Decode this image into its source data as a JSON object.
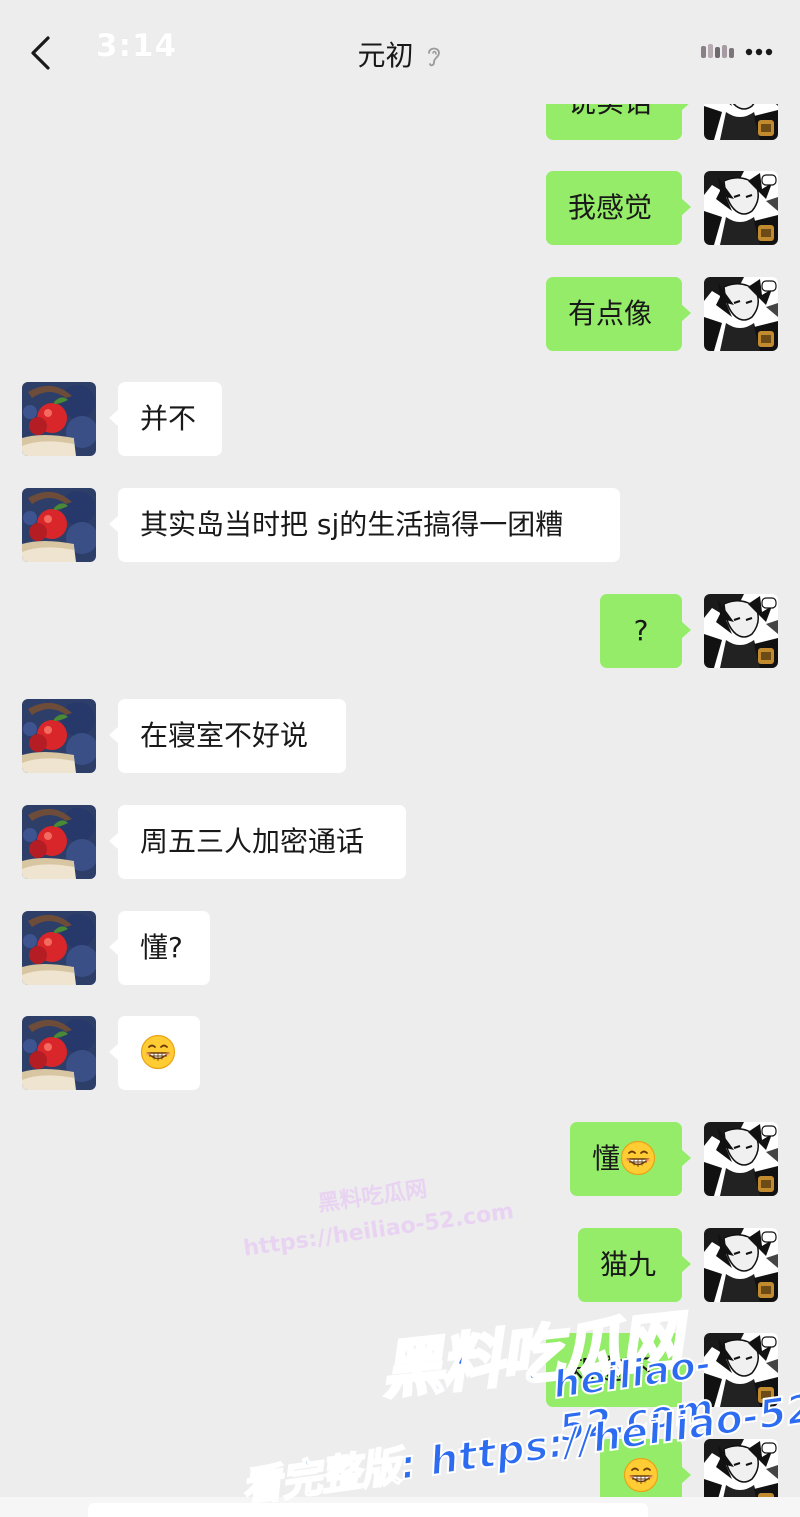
{
  "status_bar": {
    "time": "3:14"
  },
  "header": {
    "title": "元初"
  },
  "messages": [
    {
      "side": "right",
      "text": "说实话"
    },
    {
      "side": "right",
      "text": "我感觉"
    },
    {
      "side": "right",
      "text": "有点像"
    },
    {
      "side": "left",
      "text": "并不"
    },
    {
      "side": "left",
      "text": "其实岛当时把 sj的生活搞得一团糟"
    },
    {
      "side": "right",
      "text": "?"
    },
    {
      "side": "left",
      "text": "在寝室不好说"
    },
    {
      "side": "left",
      "text": "周五三人加密通话"
    },
    {
      "side": "left",
      "text": "懂?"
    },
    {
      "side": "left",
      "text": "",
      "emoji": "grin-emoji"
    },
    {
      "side": "right",
      "text": "懂",
      "emoji": "grin-emoji"
    },
    {
      "side": "right",
      "text": "猫九"
    },
    {
      "side": "right",
      "text": "知道不"
    },
    {
      "side": "right",
      "text": "",
      "emoji": "grin-emoji"
    }
  ],
  "watermark": {
    "brand": "黑料吃瓜网",
    "url": "heiliao-52.com",
    "full_version": "看完整版: https://heiliao-52.com",
    "faint_line1": "黑料吃瓜网",
    "faint_line2": "https://heiliao-52.com"
  },
  "colors": {
    "background": "#ededed",
    "self_bubble": "#95ec69",
    "other_bubble": "#ffffff",
    "watermark_blue": "#2f6df3"
  }
}
